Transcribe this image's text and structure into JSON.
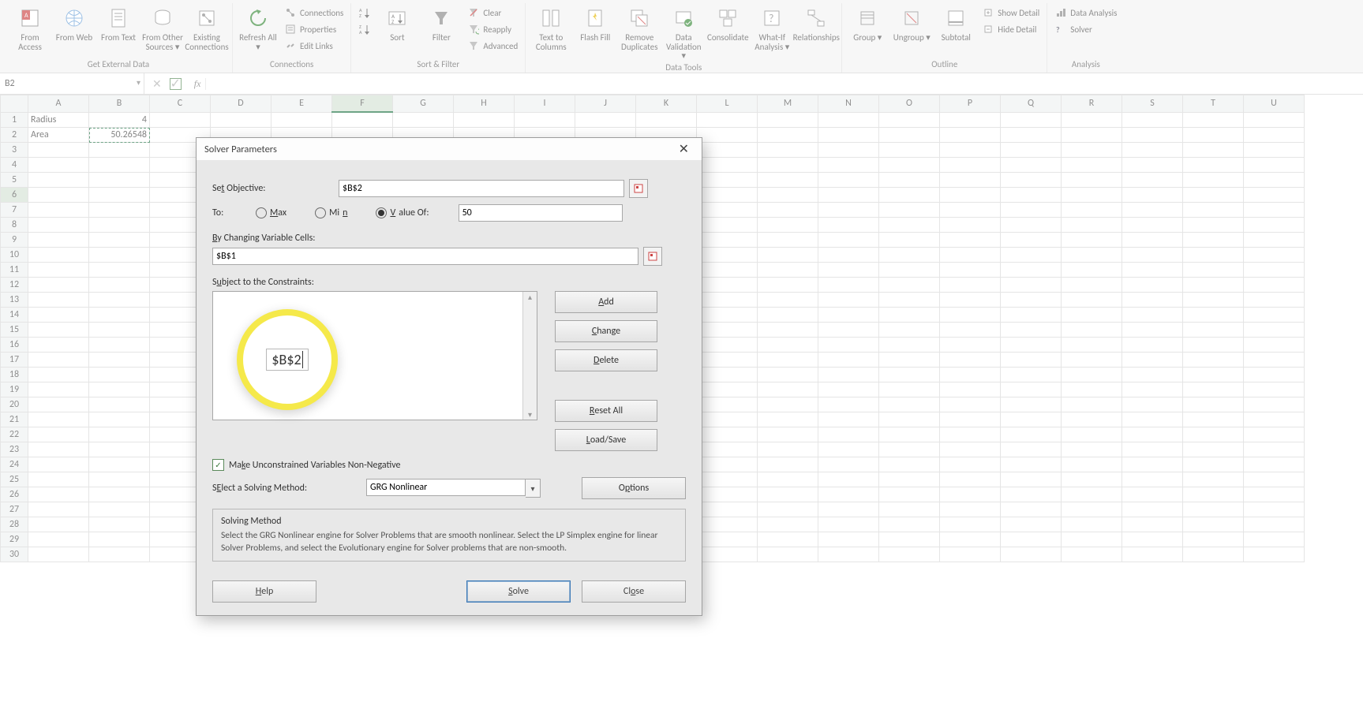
{
  "ribbon": {
    "groups": {
      "get_external": {
        "label": "Get External Data",
        "access": "From\nAccess",
        "web": "From\nWeb",
        "text": "From\nText",
        "other": "From Other\nSources ▾",
        "existing": "Existing\nConnections"
      },
      "connections": {
        "label": "Connections",
        "refresh": "Refresh\nAll ▾",
        "conn": "Connections",
        "prop": "Properties",
        "edit": "Edit Links"
      },
      "sortfilter": {
        "label": "Sort & Filter",
        "az": "A↓Z",
        "za": "Z↓A",
        "sort": "Sort",
        "filter": "Filter",
        "clear": "Clear",
        "reapply": "Reapply",
        "adv": "Advanced"
      },
      "datatools": {
        "label": "Data Tools",
        "t2c": "Text to\nColumns",
        "flash": "Flash\nFill",
        "remdup": "Remove\nDuplicates",
        "valid": "Data\nValidation ▾",
        "consol": "Consolidate",
        "whatif": "What-If\nAnalysis ▾",
        "rel": "Relationships"
      },
      "outline": {
        "label": "Outline",
        "group": "Group\n▾",
        "ungroup": "Ungroup\n▾",
        "subtotal": "Subtotal",
        "showd": "Show Detail",
        "hided": "Hide Detail"
      },
      "analysis": {
        "label": "Analysis",
        "da": "Data Analysis",
        "solver": "Solver"
      }
    }
  },
  "formula_bar": {
    "namebox": "B2",
    "fx": "fx"
  },
  "sheet": {
    "cols": [
      "A",
      "B",
      "C",
      "D",
      "E",
      "F",
      "G",
      "H",
      "I",
      "J",
      "K",
      "L",
      "M",
      "N",
      "O",
      "P",
      "Q",
      "R",
      "S",
      "T",
      "U"
    ],
    "rows": 30,
    "cells": {
      "A1": "Radius",
      "B1": "4",
      "A2": "Area",
      "B2": "50.26548"
    },
    "selected": "B6",
    "selected_col": "F",
    "marquee": "B2"
  },
  "dialog": {
    "title": "Solver Parameters",
    "set_objective_lbl": "Set Objective:",
    "set_objective_u": "t",
    "set_objective_val": "$B$2",
    "to_lbl": "To:",
    "max": "Max",
    "min": "Min",
    "valueof": "Value Of:",
    "valueof_val": "50",
    "changing_lbl": "By Changing Variable Cells:",
    "changing_u": "B",
    "changing_val": "$B$1",
    "constraints_lbl": "Subject to the Constraints:",
    "constraints_u": "u",
    "add": "Add",
    "change": "Change",
    "delete": "Delete",
    "reset": "Reset All",
    "load": "Load/Save",
    "options": "Options",
    "unconstrained": "Make Unconstrained Variables Non-Negative",
    "unconstrained_u": "k",
    "method_lbl": "Select a Solving Method:",
    "method_u": "E",
    "method_val": "GRG Nonlinear",
    "info_title": "Solving Method",
    "info_desc": "Select the GRG Nonlinear engine for Solver Problems that are smooth nonlinear. Select the LP Simplex engine for linear Solver Problems, and select the Evolutionary engine for Solver problems that are non-smooth.",
    "help": "Help",
    "solve": "Solve",
    "close": "Close"
  },
  "callout": {
    "text": "$B$2"
  }
}
